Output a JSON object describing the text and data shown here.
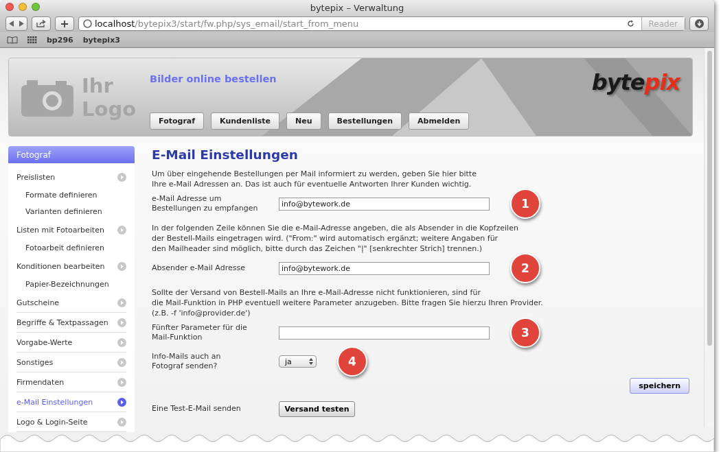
{
  "window": {
    "title": "bytepix – Verwaltung"
  },
  "toolbar": {
    "url_host": "localhost",
    "url_path": "/bytepix3/start/fw.php/sys_email/start_from_menu",
    "reader": "Reader"
  },
  "bookmarks": [
    "bp296",
    "bytepix3"
  ],
  "header": {
    "logo_lines": [
      "Ihr",
      "Logo"
    ],
    "tagline": "Bilder online bestellen",
    "brand": [
      "byte",
      "pix"
    ],
    "nav": [
      "Fotograf",
      "Kundenliste",
      "Neu",
      "Bestellungen",
      "Abmelden"
    ]
  },
  "sidebar": {
    "title": "Fotograf",
    "items": [
      {
        "kind": "main",
        "label": "Preislisten",
        "selected": false,
        "divider": false
      },
      {
        "kind": "sub",
        "label": "Formate definieren",
        "selected": false,
        "divider": false
      },
      {
        "kind": "sub",
        "label": "Varianten definieren",
        "selected": false,
        "divider": false
      },
      {
        "kind": "main",
        "label": "Listen mit Fotoarbeiten",
        "selected": false,
        "divider": false
      },
      {
        "kind": "sub",
        "label": "Fotoarbeit definieren",
        "selected": false,
        "divider": false
      },
      {
        "kind": "main",
        "label": "Konditionen bearbeiten",
        "selected": false,
        "divider": false
      },
      {
        "kind": "sub",
        "label": "Papier-Bezeichnungen",
        "selected": false,
        "divider": false
      },
      {
        "kind": "main",
        "label": "Gutscheine",
        "selected": false,
        "divider": true
      },
      {
        "kind": "main",
        "label": "Begriffe & Textpassagen",
        "selected": false,
        "divider": true
      },
      {
        "kind": "main",
        "label": "Vorgabe-Werte",
        "selected": false,
        "divider": true
      },
      {
        "kind": "main",
        "label": "Sonstiges",
        "selected": false,
        "divider": true
      },
      {
        "kind": "main",
        "label": "Firmendaten",
        "selected": false,
        "divider": true
      },
      {
        "kind": "main",
        "label": "e-Mail Einstellungen",
        "selected": true,
        "divider": true
      },
      {
        "kind": "main",
        "label": "Logo & Login-Seite",
        "selected": false,
        "divider": true
      }
    ]
  },
  "main": {
    "title": "E-Mail Einstellungen",
    "blocks": [
      {
        "kind": "paragraph",
        "lines": [
          "Um über eingehende Bestellungen per Mail informiert zu werden, geben Sie hier bitte",
          "Ihre e-Mail Adressen an. Das ist auch für eventuelle Antworten Ihrer Kunden wichtig."
        ]
      },
      {
        "kind": "input",
        "label_lines": [
          "e-Mail Adresse um",
          "Bestellungen zu empfangen"
        ],
        "value": "info@bytework.de",
        "badge": "1"
      },
      {
        "kind": "paragraph",
        "lines": [
          "In der folgenden Zeile können Sie die e-Mail-Adresse angeben, die als Absender in die Kopfzeilen",
          "der Bestell-Mails eingetragen wird. (\"From:\" wird automatisch ergänzt; weitere Angaben für",
          "den Mailheader sind möglich, bitte durch das Zeichen \"|\" [senkrechter Strich] trennen.)"
        ]
      },
      {
        "kind": "input",
        "label_lines": [
          "Absender e-Mail Adresse"
        ],
        "value": "info@bytework.de",
        "badge": "2"
      },
      {
        "kind": "paragraph",
        "lines": [
          "Sollte der Versand von Bestell-Mails an Ihre e-Mail-Adresse nicht funktionieren, sind für",
          "die Mail-Funktion in PHP eventuell weitere Parameter anzugeben. Bitte fragen Sie hierzu Ihren Provider.",
          "(z.B. -f 'info@provider.de')"
        ]
      },
      {
        "kind": "input",
        "label_lines": [
          "Fünfter Parameter für die",
          "Mail-Funktion"
        ],
        "badge": "3"
      },
      {
        "kind": "select",
        "label_lines": [
          "Info-Mails auch an",
          "Fotograf senden?"
        ],
        "value": "ja",
        "badge": "4"
      },
      {
        "kind": "save",
        "button": "speichern"
      },
      {
        "kind": "action",
        "label_lines": [
          "Eine Test-E-Mail senden"
        ],
        "button": "Versand testen"
      }
    ]
  }
}
